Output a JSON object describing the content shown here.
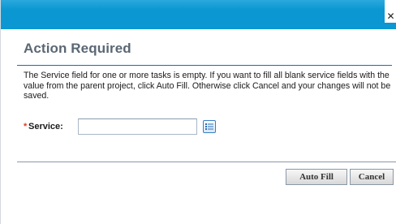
{
  "window": {
    "close_glyph": "✕",
    "titlebar_color": "#0b97d1"
  },
  "dialog": {
    "title": "Action Required",
    "message": "The Service field for one or more tasks is empty. If you want to fill all blank service fields with the value from the parent project, click Auto Fill. Otherwise click Cancel and your changes will not be saved.",
    "field": {
      "required_marker": "*",
      "label": "Service:",
      "value": "",
      "list_icon": "list-icon"
    },
    "buttons": {
      "auto_fill": "Auto Fill",
      "cancel": "Cancel"
    }
  },
  "colors": {
    "accent": "#0b97d1",
    "required": "#e03a2b",
    "heading": "#5a6774",
    "rule": "#1b6fa8"
  }
}
